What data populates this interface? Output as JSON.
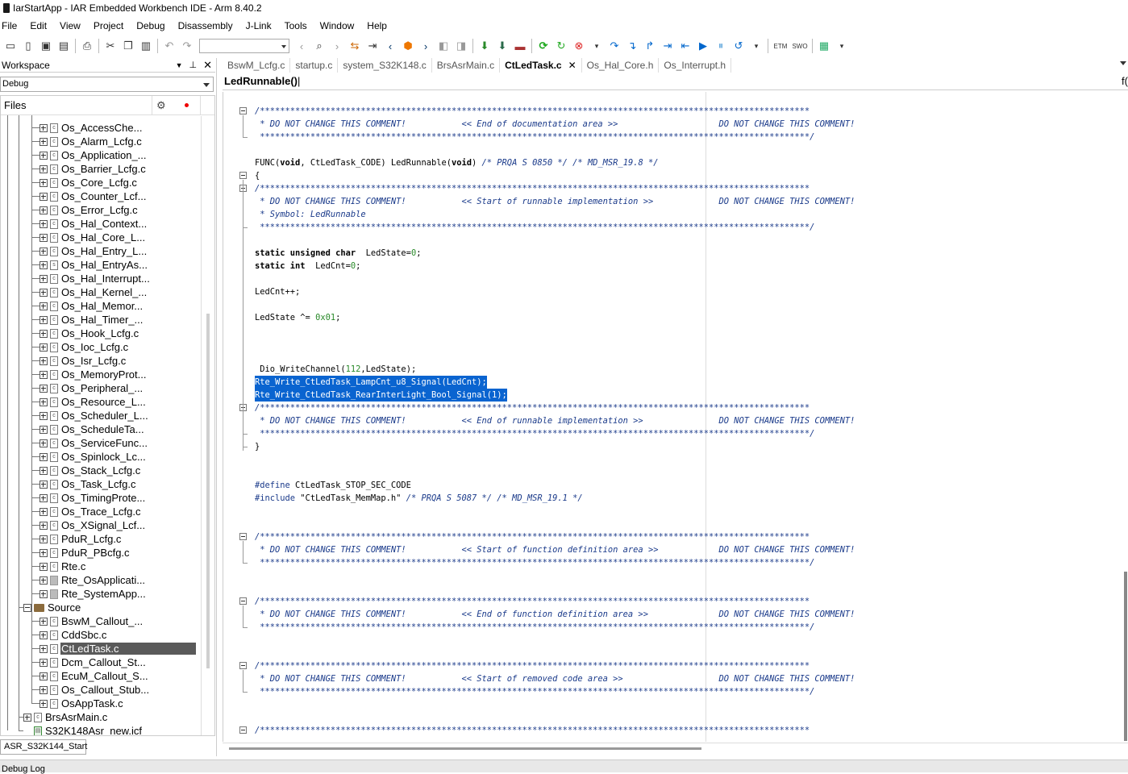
{
  "window": {
    "title": "IarStartApp - IAR Embedded Workbench IDE - Arm 8.40.2"
  },
  "menu": [
    "File",
    "Edit",
    "View",
    "Project",
    "Debug",
    "Disassembly",
    "J-Link",
    "Tools",
    "Window",
    "Help"
  ],
  "toolbar": {
    "etm_label": "ETM",
    "swo_label": "SWO"
  },
  "workspace": {
    "title": "Workspace",
    "config": "Debug",
    "files_label": "Files",
    "project_tab": "ASR_S32K144_Start"
  },
  "tree": [
    {
      "label": "Os_AccessChe...",
      "icon": "c"
    },
    {
      "label": "Os_Alarm_Lcfg.c",
      "icon": "c"
    },
    {
      "label": "Os_Application_...",
      "icon": "c"
    },
    {
      "label": "Os_Barrier_Lcfg.c",
      "icon": "c"
    },
    {
      "label": "Os_Core_Lcfg.c",
      "icon": "c"
    },
    {
      "label": "Os_Counter_Lcf...",
      "icon": "c"
    },
    {
      "label": "Os_Error_Lcfg.c",
      "icon": "c"
    },
    {
      "label": "Os_Hal_Context...",
      "icon": "c"
    },
    {
      "label": "Os_Hal_Core_L...",
      "icon": "c"
    },
    {
      "label": "Os_Hal_Entry_L...",
      "icon": "c"
    },
    {
      "label": "Os_Hal_EntryAs...",
      "icon": "s"
    },
    {
      "label": "Os_Hal_Interrupt...",
      "icon": "c"
    },
    {
      "label": "Os_Hal_Kernel_...",
      "icon": "c"
    },
    {
      "label": "Os_Hal_Memor...",
      "icon": "c"
    },
    {
      "label": "Os_Hal_Timer_...",
      "icon": "c"
    },
    {
      "label": "Os_Hook_Lcfg.c",
      "icon": "c"
    },
    {
      "label": "Os_Ioc_Lcfg.c",
      "icon": "c"
    },
    {
      "label": "Os_Isr_Lcfg.c",
      "icon": "c"
    },
    {
      "label": "Os_MemoryProt...",
      "icon": "c"
    },
    {
      "label": "Os_Peripheral_...",
      "icon": "c"
    },
    {
      "label": "Os_Resource_L...",
      "icon": "c"
    },
    {
      "label": "Os_Scheduler_L...",
      "icon": "c"
    },
    {
      "label": "Os_ScheduleTa...",
      "icon": "c"
    },
    {
      "label": "Os_ServiceFunc...",
      "icon": "c"
    },
    {
      "label": "Os_Spinlock_Lc...",
      "icon": "c"
    },
    {
      "label": "Os_Stack_Lcfg.c",
      "icon": "c"
    },
    {
      "label": "Os_Task_Lcfg.c",
      "icon": "c"
    },
    {
      "label": "Os_TimingProte...",
      "icon": "c"
    },
    {
      "label": "Os_Trace_Lcfg.c",
      "icon": "c"
    },
    {
      "label": "Os_XSignal_Lcf...",
      "icon": "c"
    },
    {
      "label": "PduR_Lcfg.c",
      "icon": "c"
    },
    {
      "label": "PduR_PBcfg.c",
      "icon": "c"
    },
    {
      "label": "Rte.c",
      "icon": "c"
    },
    {
      "label": "Rte_OsApplicati...",
      "icon": "grey"
    },
    {
      "label": "Rte_SystemApp...",
      "icon": "grey"
    },
    {
      "label": "Source",
      "icon": "folder"
    },
    {
      "label": "BswM_Callout_...",
      "icon": "c"
    },
    {
      "label": "CddSbc.c",
      "icon": "c"
    },
    {
      "label": "CtLedTask.c",
      "icon": "c",
      "selected": true
    },
    {
      "label": "Dcm_Callout_St...",
      "icon": "c"
    },
    {
      "label": "EcuM_Callout_S...",
      "icon": "c"
    },
    {
      "label": "Os_Callout_Stub...",
      "icon": "c"
    },
    {
      "label": "OsAppTask.c",
      "icon": "c"
    },
    {
      "label": "BrsAsrMain.c",
      "icon": "c"
    },
    {
      "label": "S32K148Asr_new.icf",
      "icon": "green"
    }
  ],
  "editor": {
    "tabs": [
      "BswM_Lcfg.c",
      "startup.c",
      "system_S32K148.c",
      "BrsAsrMain.c",
      "CtLedTask.c",
      "Os_Hal_Core.h",
      "Os_Interrupt.h"
    ],
    "active_tab": "CtLedTask.c",
    "function": "LedRunnable()",
    "function_right": "f("
  },
  "code": [
    {
      "t": "/*************************************************************************************************************",
      "c": "cm"
    },
    {
      "t": " * DO NOT CHANGE THIS COMMENT!           << End of documentation area >>                    DO NOT CHANGE THIS COMMENT!",
      "c": "cm"
    },
    {
      "t": " *************************************************************************************************************/",
      "c": "cm"
    },
    {
      "t": "",
      "c": ""
    },
    {
      "t": "FUNC(void, CtLedTask_CODE) LedRunnable(void) /* PRQA S 0850 */ /* MD_MSR_19.8 */",
      "c": "func"
    },
    {
      "t": "{",
      "c": ""
    },
    {
      "t": "/*************************************************************************************************************",
      "c": "cm"
    },
    {
      "t": " * DO NOT CHANGE THIS COMMENT!           << Start of runnable implementation >>             DO NOT CHANGE THIS COMMENT!",
      "c": "cm"
    },
    {
      "t": " * Symbol: LedRunnable",
      "c": "cm"
    },
    {
      "t": " *************************************************************************************************************/",
      "c": "cm"
    },
    {
      "t": "",
      "c": ""
    },
    {
      "t": "static unsigned char  LedState=0;",
      "c": "decl1"
    },
    {
      "t": "static int  LedCnt=0;",
      "c": "decl2"
    },
    {
      "t": "",
      "c": ""
    },
    {
      "t": "LedCnt++;",
      "c": ""
    },
    {
      "t": "",
      "c": ""
    },
    {
      "t": "LedState ^= 0x01;",
      "c": "xor"
    },
    {
      "t": "",
      "c": ""
    },
    {
      "t": "",
      "c": ""
    },
    {
      "t": "",
      "c": ""
    },
    {
      "t": " Dio_WriteChannel(112,LedState);",
      "c": "dio"
    },
    {
      "t": "Rte_Write_CtLedTask_LampCnt_u8_Signal(LedCnt);",
      "c": "hl"
    },
    {
      "t": "Rte_Write_CtLedTask_RearInterLight_Bool_Signal(1);",
      "c": "hl"
    },
    {
      "t": "/*************************************************************************************************************",
      "c": "cm"
    },
    {
      "t": " * DO NOT CHANGE THIS COMMENT!           << End of runnable implementation >>               DO NOT CHANGE THIS COMMENT!",
      "c": "cm"
    },
    {
      "t": " *************************************************************************************************************/",
      "c": "cm"
    },
    {
      "t": "}",
      "c": ""
    },
    {
      "t": "",
      "c": ""
    },
    {
      "t": "",
      "c": ""
    },
    {
      "t": "#define CtLedTask_STOP_SEC_CODE",
      "c": "define"
    },
    {
      "t": "#include \"CtLedTask_MemMap.h\" /* PRQA S 5087 */ /* MD_MSR_19.1 */",
      "c": "include"
    },
    {
      "t": "",
      "c": ""
    },
    {
      "t": "",
      "c": ""
    },
    {
      "t": "/*************************************************************************************************************",
      "c": "cm"
    },
    {
      "t": " * DO NOT CHANGE THIS COMMENT!           << Start of function definition area >>            DO NOT CHANGE THIS COMMENT!",
      "c": "cm"
    },
    {
      "t": " *************************************************************************************************************/",
      "c": "cm"
    },
    {
      "t": "",
      "c": ""
    },
    {
      "t": "",
      "c": ""
    },
    {
      "t": "/*************************************************************************************************************",
      "c": "cm"
    },
    {
      "t": " * DO NOT CHANGE THIS COMMENT!           << End of function definition area >>              DO NOT CHANGE THIS COMMENT!",
      "c": "cm"
    },
    {
      "t": " *************************************************************************************************************/",
      "c": "cm"
    },
    {
      "t": "",
      "c": ""
    },
    {
      "t": "",
      "c": ""
    },
    {
      "t": "/*************************************************************************************************************",
      "c": "cm"
    },
    {
      "t": " * DO NOT CHANGE THIS COMMENT!           << Start of removed code area >>                   DO NOT CHANGE THIS COMMENT!",
      "c": "cm"
    },
    {
      "t": " *************************************************************************************************************/",
      "c": "cm"
    },
    {
      "t": "",
      "c": ""
    },
    {
      "t": "",
      "c": ""
    },
    {
      "t": "/*************************************************************************************************************",
      "c": "cm"
    }
  ],
  "bottom": {
    "label": "Debug Log"
  }
}
